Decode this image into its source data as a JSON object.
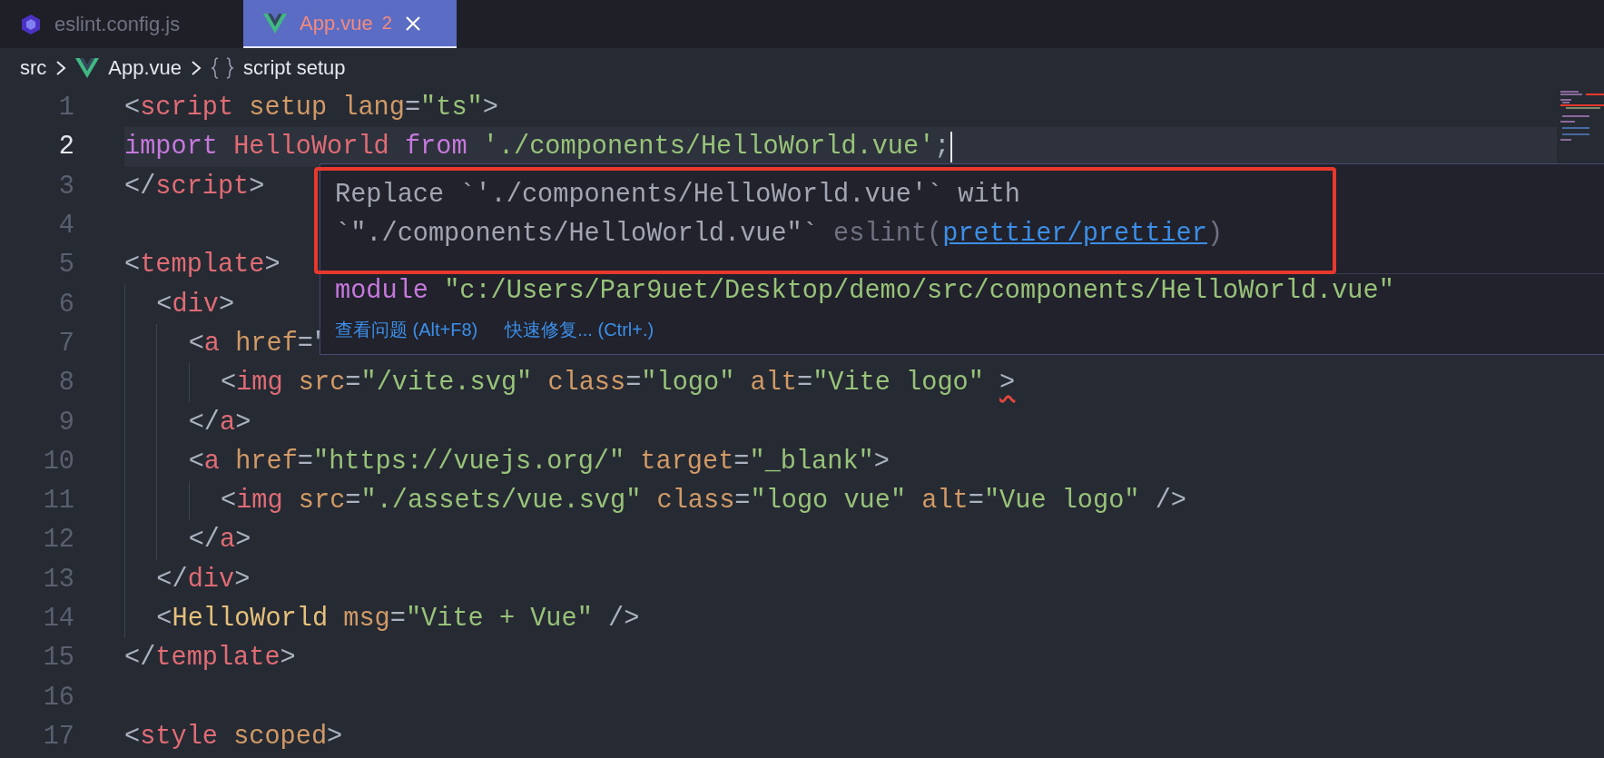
{
  "tabs": [
    {
      "label": "eslint.config.js",
      "kind": "config",
      "selected": false
    },
    {
      "label": "App.vue",
      "kind": "vue",
      "problems": "2",
      "selected": true
    }
  ],
  "breadcrumb": [
    {
      "label": "src",
      "kind": "folder"
    },
    {
      "label": "App.vue",
      "kind": "vue"
    },
    {
      "label": "script setup",
      "kind": "symbol"
    }
  ],
  "lines": [
    {
      "number": "1",
      "kind": "html",
      "current": false,
      "error": false,
      "text": "<script setup lang=\"ts\">"
    },
    {
      "number": "2",
      "kind": "js",
      "current": true,
      "error": false,
      "text": "import HelloWorld from './components/HelloWorld.vue';"
    },
    {
      "number": "3",
      "kind": "html",
      "current": false,
      "error": false,
      "text": "</script>"
    },
    {
      "number": "4",
      "current": false,
      "error": false
    },
    {
      "number": "5",
      "kind": "html",
      "current": false,
      "error": false,
      "text": "<template>"
    },
    {
      "number": "6",
      "kind": "html",
      "current": false,
      "error": false,
      "text": "  <div>"
    },
    {
      "number": "7",
      "kind": "html",
      "current": false,
      "error": false,
      "text": "    <a href=\""
    },
    {
      "number": "8",
      "kind": "html",
      "current": false,
      "error": true,
      "text": "      <img src=\"/vite.svg\" class=\"logo\" alt=\"Vite logo\" >"
    },
    {
      "number": "9",
      "kind": "html",
      "current": false,
      "error": false,
      "text": "    </a>"
    },
    {
      "number": "10",
      "kind": "html",
      "current": false,
      "error": false,
      "text": "    <a href=\"https://vuejs.org/\" target=\"_blank\">"
    },
    {
      "number": "11",
      "kind": "html",
      "current": false,
      "error": false,
      "text": "      <img src=\"./assets/vue.svg\" class=\"logo vue\" alt=\"Vue logo\" />"
    },
    {
      "number": "12",
      "kind": "html",
      "current": false,
      "error": false,
      "text": "    </a>"
    },
    {
      "number": "13",
      "kind": "html",
      "current": false,
      "error": false,
      "text": "  </div>"
    },
    {
      "number": "14",
      "kind": "html",
      "current": false,
      "error": false,
      "text": "  <HelloWorld msg=\"Vite + Vue\" />"
    },
    {
      "number": "15",
      "kind": "html",
      "current": false,
      "error": false,
      "text": "</template>"
    },
    {
      "number": "16",
      "current": false,
      "error": false
    },
    {
      "number": "17",
      "kind": "html",
      "current": false,
      "error": false,
      "text": "<style scoped>"
    }
  ],
  "hover": {
    "message_lines": [
      "Replace `'./components/HelloWorld.vue'` with",
      "`\"./components/HelloWorld.vue\"`"
    ],
    "source_open": "eslint(",
    "rule": "prettier/prettier",
    "source_close": ")",
    "module_keyword": "module",
    "module_path": "\"c:/Users/Par9uet/Desktop/demo/src/components/HelloWorld.vue\"",
    "actions": [
      "查看问题 (Alt+F8)",
      "快速修复... (Ctrl+.)"
    ]
  }
}
